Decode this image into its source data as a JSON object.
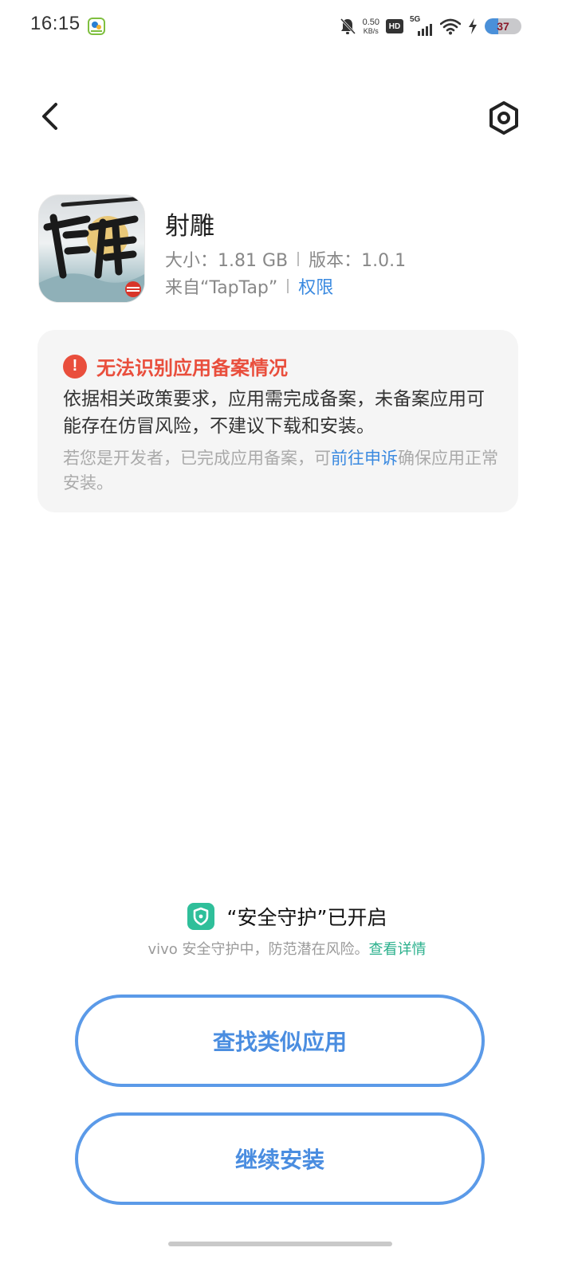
{
  "status_bar": {
    "time": "16:15",
    "net_speed_value": "0.50",
    "net_speed_unit": "KB/s",
    "hd_label": "HD",
    "network_label": "5G",
    "battery_level": "37",
    "battery_fill_percent": 37
  },
  "app": {
    "name": "射雕",
    "size_text": "大小：1.81 GB",
    "version_text": "版本：1.0.1",
    "source_text": "来自“TapTap”",
    "permissions_link": "权限"
  },
  "warning": {
    "title": "无法识别应用备案情况",
    "body": "依据相关政策要求，应用需完成备案，未备案应用可能存在仿冒风险，不建议下载和安装。",
    "note_prefix": "若您是开发者，已完成应用备案，可",
    "note_link": "前往申诉",
    "note_suffix": "确保应用正常安装。"
  },
  "security": {
    "title": "“安全守护”已开启",
    "subtitle": "vivo 安全守护中，防范潜在风险。",
    "details_link": "查看详情"
  },
  "buttons": {
    "find_similar": "查找类似应用",
    "continue_install": "继续安装"
  },
  "colors": {
    "accent_blue": "#4a8de0",
    "warning_red": "#e94e3c",
    "security_green": "#2fbf9a"
  }
}
